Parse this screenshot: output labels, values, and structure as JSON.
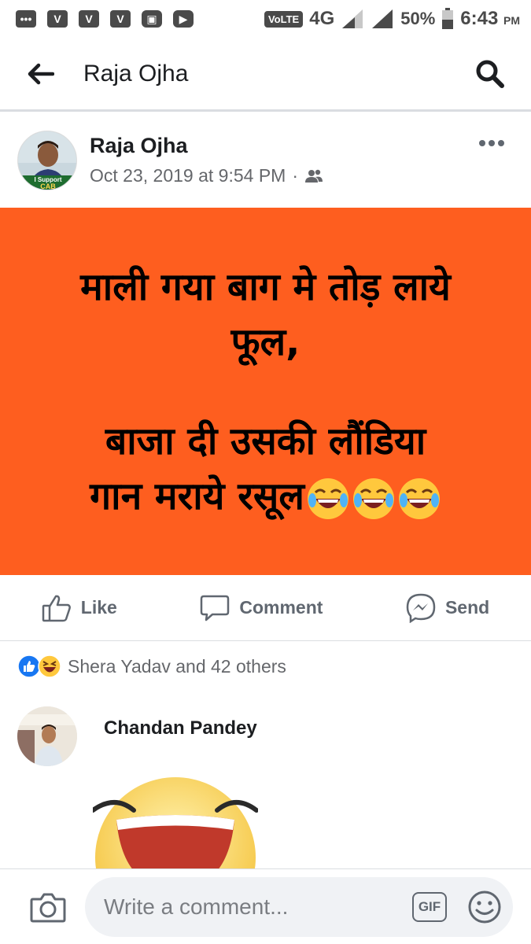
{
  "status_bar": {
    "network_label": "VoLTE",
    "network_type": "4G",
    "battery": "50%",
    "time": "6:43",
    "meridiem": "PM",
    "icons": [
      "message-icon",
      "v-app-icon",
      "v-app-icon",
      "v-app-icon",
      "gallery-icon",
      "youtube-icon",
      "signal-icon",
      "signal-icon",
      "battery-icon"
    ]
  },
  "app_bar": {
    "title": "Raja Ojha",
    "icons": [
      "back-arrow-icon",
      "search-icon"
    ]
  },
  "post": {
    "author": "Raja Ojha",
    "timestamp": "Oct 23, 2019 at 9:54 PM",
    "separator": "·",
    "privacy_icon": "friends-icon",
    "avatar_badge_line1": "I Support",
    "avatar_badge_line2": "CAB",
    "image_lines": [
      "माली गया बाग मे तोड़ लाये",
      "फूल,",
      "बाजा दी उसकी लौंडिया",
      "गान मराये रसूल"
    ],
    "image_background": "#fe5e1f",
    "image_emoji": "tears-of-joy-icon"
  },
  "actions": {
    "like": "Like",
    "comment": "Comment",
    "send": "Send"
  },
  "reactions": {
    "summary": "Shera Yadav and 42 others",
    "icons": [
      "like-reaction-icon",
      "haha-reaction-icon"
    ],
    "like_color": "#1877f2"
  },
  "comment": {
    "author": "Chandan Pandey",
    "content_icon": "laughing-sticker-icon"
  },
  "composer": {
    "placeholder": "Write a comment...",
    "gif_label": "GIF"
  }
}
